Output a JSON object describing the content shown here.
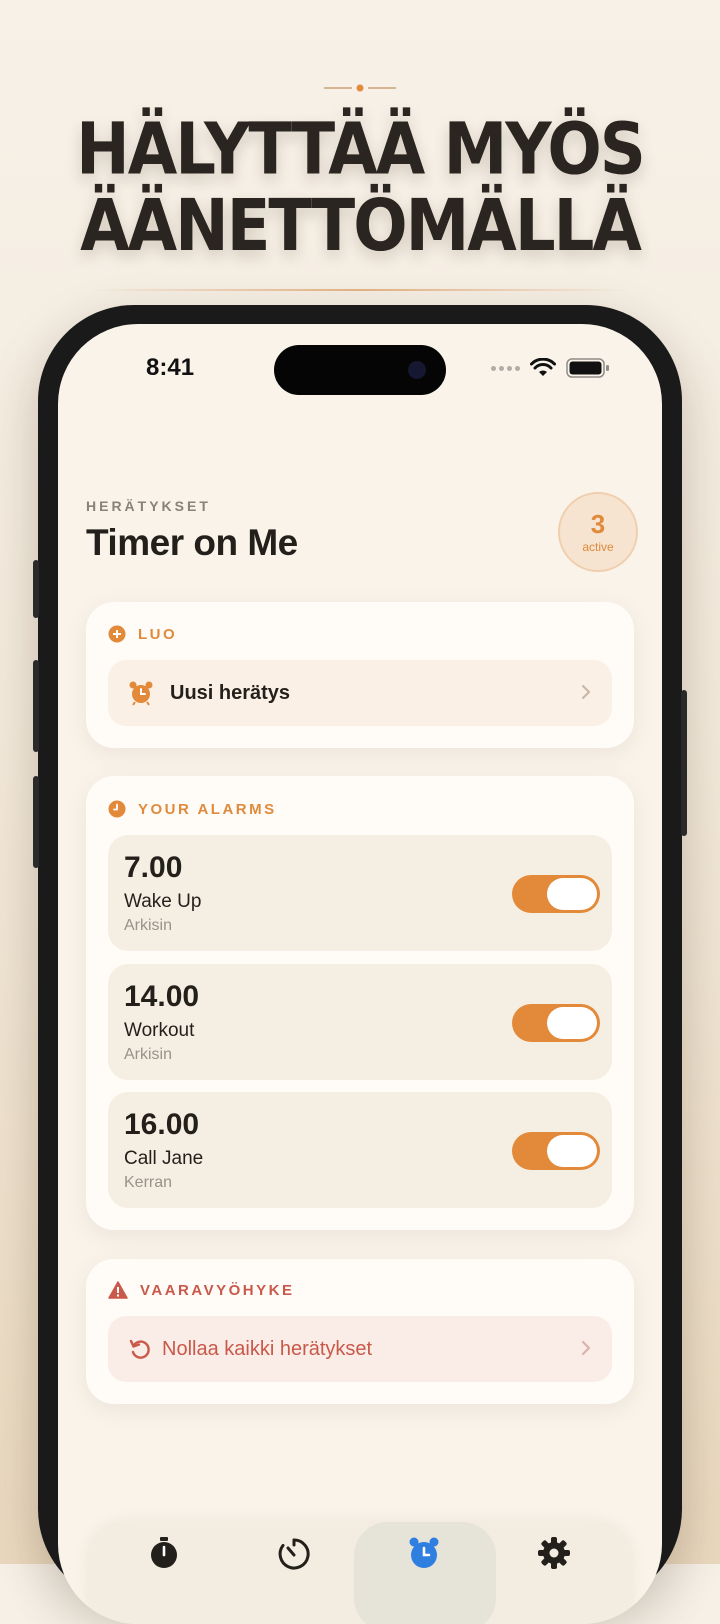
{
  "headline": {
    "line1": "HÄLYTTÄÄ MYÖS",
    "line2": "ÄÄNETTÖMÄLLÄ"
  },
  "status_bar": {
    "time": "8:41"
  },
  "header": {
    "eyebrow": "HERÄTYKSET",
    "title": "Timer on Me"
  },
  "badge": {
    "count": "3",
    "label": "active"
  },
  "create_section": {
    "heading": "LUO",
    "new_alarm_label": "Uusi herätys"
  },
  "alarms_section": {
    "heading": "YOUR ALARMS",
    "alarms": [
      {
        "time": "7.00",
        "name": "Wake Up",
        "repeat": "Arkisin",
        "enabled": true
      },
      {
        "time": "14.00",
        "name": "Workout",
        "repeat": "Arkisin",
        "enabled": true
      },
      {
        "time": "16.00",
        "name": "Call Jane",
        "repeat": "Kerran",
        "enabled": true
      }
    ]
  },
  "danger_section": {
    "heading": "VAARAVYÖHYKE",
    "reset_label": "Nollaa kaikki herätykset"
  },
  "tabbar": {
    "tabs": [
      {
        "icon": "stopwatch-icon",
        "active": false
      },
      {
        "icon": "timer-icon",
        "active": false
      },
      {
        "icon": "alarm-clock-icon",
        "active": true
      },
      {
        "icon": "gear-icon",
        "active": false
      }
    ]
  },
  "colors": {
    "accent": "#e3893a",
    "danger": "#c9594a",
    "active_tab": "#2f7fe0",
    "text": "#231f1b"
  }
}
